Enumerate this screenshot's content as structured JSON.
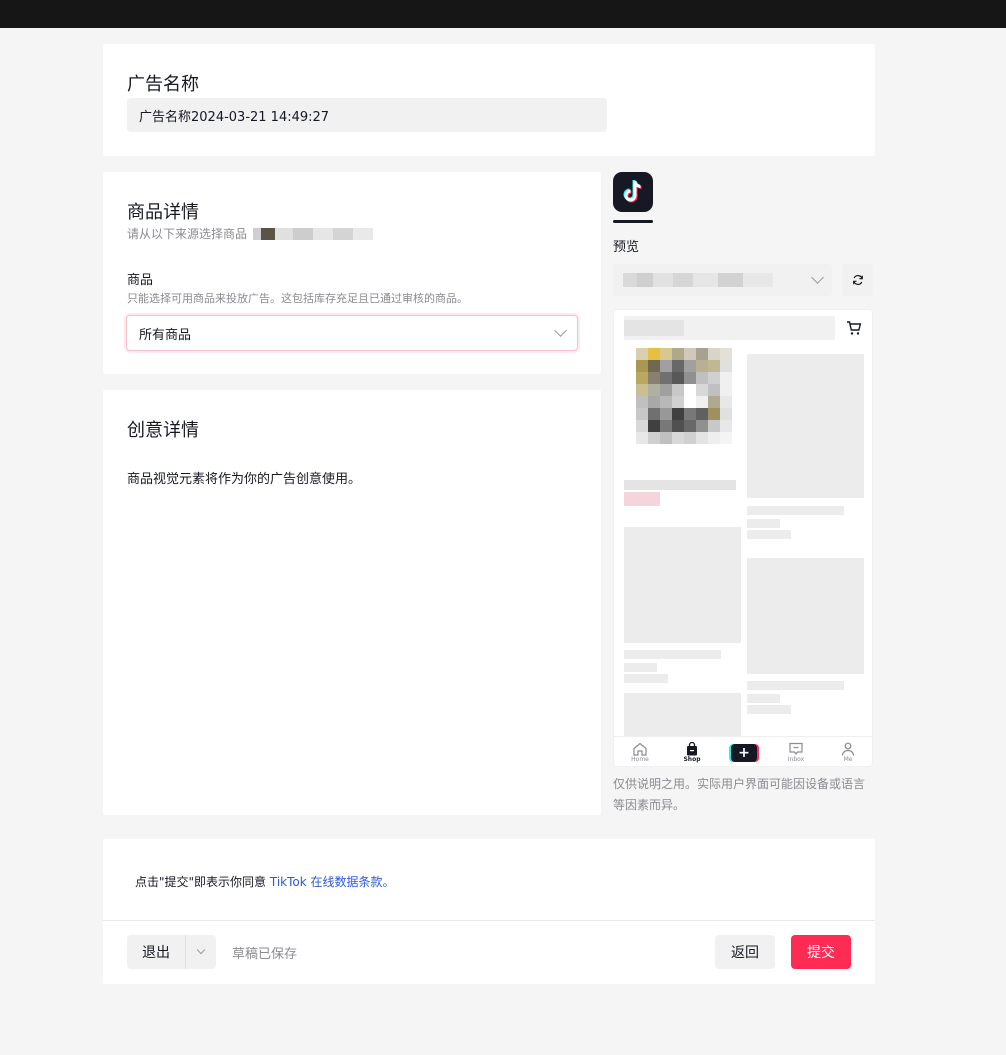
{
  "ad_name": {
    "title": "广告名称",
    "value": "广告名称2024-03-21 14:49:27"
  },
  "product_details": {
    "title": "商品详情",
    "subtitle": "请从以下来源选择商品",
    "goods_label": "商品",
    "goods_hint": "只能选择可用商品来投放广告。这包括库存充足且已通过审核的商品。",
    "goods_select_value": "所有商品"
  },
  "creative_details": {
    "title": "创意详情",
    "description": "商品视觉元素将作为你的广告创意使用。"
  },
  "preview": {
    "label": "预览",
    "tabs": [
      "Home",
      "Shop",
      "Inbox",
      "Me"
    ],
    "note": "仅供说明之用。实际用户界面可能因设备或语言等因素而异。"
  },
  "footer": {
    "agree_prefix": "点击\"提交\"即表示你同意",
    "agree_link": "TikTok 在线数据条款。",
    "exit_label": "退出",
    "draft_status": "草稿已保存",
    "back_label": "返回",
    "submit_label": "提交"
  },
  "colors": {
    "accent": "#fe2c55",
    "link": "#2d5ad6",
    "page_bg": "#f5f5f5"
  }
}
